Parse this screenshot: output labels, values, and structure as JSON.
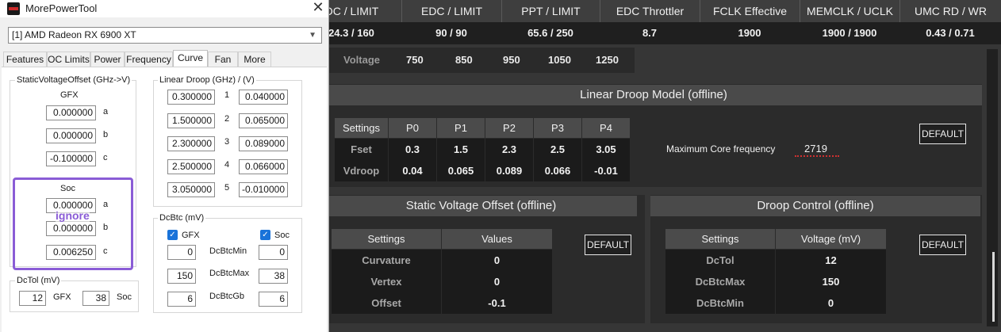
{
  "window": {
    "title": "MorePowerTool",
    "device": "[1] AMD Radeon RX 6900 XT",
    "tabs": [
      "Features",
      "OC Limits",
      "Power",
      "Frequency",
      "Curve",
      "Fan",
      "More"
    ],
    "active_tab": "Curve"
  },
  "svo": {
    "group_title": "StaticVoltageOffset (GHz->V)",
    "gfx_label": "GFX",
    "gfx": [
      {
        "label": "a",
        "value": "0.000000"
      },
      {
        "label": "b",
        "value": "0.000000"
      },
      {
        "label": "c",
        "value": "-0.100000"
      }
    ],
    "soc_label": "Soc",
    "soc": [
      {
        "label": "a",
        "value": "0.000000"
      },
      {
        "label": "b",
        "value": "0.000000"
      },
      {
        "label": "c",
        "value": "0.006250"
      }
    ],
    "annotation": "ignore"
  },
  "droop": {
    "group_title": "Linear Droop (GHz) / (V)",
    "rows": [
      {
        "idx": "1",
        "freq": "0.300000",
        "volt": "0.040000"
      },
      {
        "idx": "2",
        "freq": "1.500000",
        "volt": "0.065000"
      },
      {
        "idx": "3",
        "freq": "2.300000",
        "volt": "0.089000"
      },
      {
        "idx": "4",
        "freq": "2.500000",
        "volt": "0.066000"
      },
      {
        "idx": "5",
        "freq": "3.050000",
        "volt": "-0.010000"
      }
    ]
  },
  "dcbtc": {
    "group_title": "DcBtc (mV)",
    "gfx_label": "GFX",
    "soc_label": "Soc",
    "rows": [
      {
        "label": "DcBtcMin",
        "gfx": "0",
        "soc": "0"
      },
      {
        "label": "DcBtcMax",
        "gfx": "150",
        "soc": "38"
      },
      {
        "label": "DcBtcGb",
        "gfx": "6",
        "soc": "6"
      }
    ]
  },
  "dctol": {
    "group_title": "DcTol (mV)",
    "gfx_value": "12",
    "gfx_label": "GFX",
    "soc_value": "38",
    "soc_label": "Soc"
  },
  "bg": {
    "headers": [
      "DC / LIMIT",
      "EDC / LIMIT",
      "PPT / LIMIT",
      "EDC Throttler",
      "FCLK Effective",
      "MEMCLK / UCLK",
      "UMC RD / WR"
    ],
    "values": [
      "24.3 / 160",
      "90 / 90",
      "65.6 / 250",
      "8.7",
      "1900",
      "1900 / 1900",
      "0.43 / 0.71"
    ],
    "voltage_label": "Voltage",
    "voltages": [
      "750",
      "850",
      "950",
      "1050",
      "1250"
    ],
    "linear_droop": {
      "title": "Linear Droop Model (offline)",
      "columns": [
        "Settings",
        "P0",
        "P1",
        "P2",
        "P3",
        "P4"
      ],
      "rows": [
        {
          "label": "Fset",
          "values": [
            "0.3",
            "1.5",
            "2.3",
            "2.5",
            "3.05"
          ]
        },
        {
          "label": "Vdroop",
          "values": [
            "0.04",
            "0.065",
            "0.089",
            "0.066",
            "-0.01"
          ]
        }
      ],
      "max_freq_label": "Maximum Core frequency",
      "max_freq_value": "2719",
      "default_btn": "DEFAULT"
    },
    "svo": {
      "title": "Static Voltage Offset (offline)",
      "columns": [
        "Settings",
        "Values"
      ],
      "rows": [
        {
          "label": "Curvature",
          "value": "0"
        },
        {
          "label": "Vertex",
          "value": "0"
        },
        {
          "label": "Offset",
          "value": "-0.1"
        }
      ],
      "default_btn": "DEFAULT"
    },
    "droop_control": {
      "title": "Droop Control (offline)",
      "columns": [
        "Settings",
        "Voltage (mV)"
      ],
      "rows": [
        {
          "label": "DcTol",
          "value": "12"
        },
        {
          "label": "DcBtcMax",
          "value": "150"
        },
        {
          "label": "DcBtcMin",
          "value": "0"
        }
      ],
      "default_btn": "DEFAULT"
    }
  }
}
